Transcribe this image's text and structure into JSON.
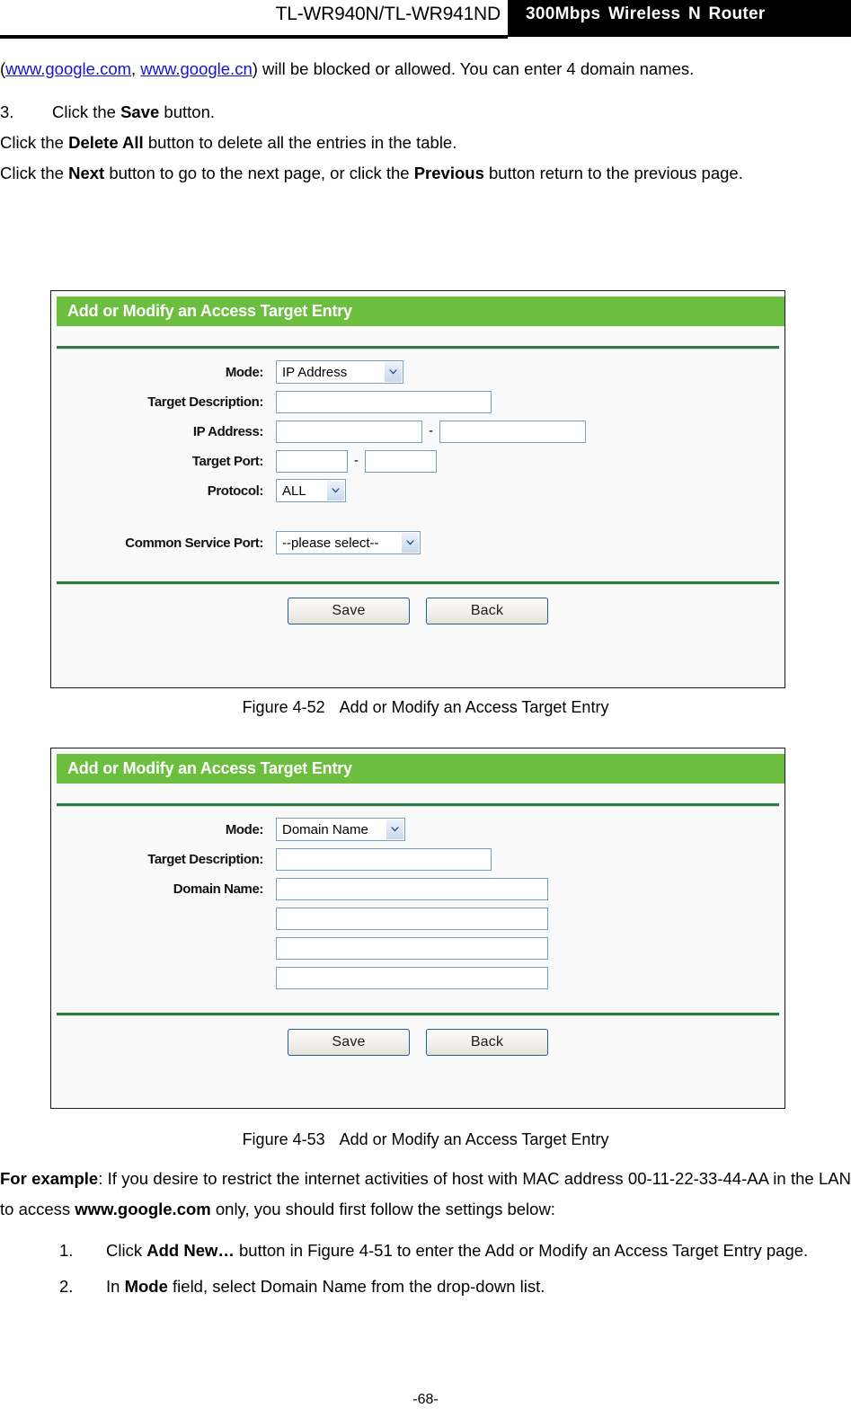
{
  "header": {
    "model": "TL-WR940N/TL-WR941ND",
    "product": "300Mbps Wireless N Router"
  },
  "top_text": {
    "para1_open": "(",
    "link1": "www.google.com",
    "para1_mid": ", ",
    "link2": "www.google.cn",
    "para1_rest": ") will be blocked or allowed. You can enter 4 domain names.",
    "item3_num": "3.",
    "item3_pre": "Click the ",
    "item3_bold": "Save",
    "item3_post": " button.",
    "para_delete_pre": "Click the ",
    "para_delete_bold": "Delete All",
    "para_delete_post": " button to delete all the entries in the table.",
    "para_next_pre": "Click the ",
    "para_next_bold1": "Next",
    "para_next_mid": " button to go to the next page, or click the ",
    "para_next_bold2": "Previous",
    "para_next_post": " button return to the previous page."
  },
  "figure1": {
    "panel_title": "Add or Modify an Access Target Entry",
    "labels": {
      "mode": "Mode:",
      "target_description": "Target Description:",
      "ip_address": "IP Address:",
      "target_port": "Target Port:",
      "protocol": "Protocol:",
      "common_service_port": "Common Service Port:"
    },
    "values": {
      "mode": "IP Address",
      "target_description": "",
      "ip_address_start": "",
      "ip_address_end": "",
      "target_port_start": "",
      "target_port_end": "",
      "protocol": "ALL",
      "common_service_port": "--please select--"
    },
    "separator": "-",
    "buttons": {
      "save": "Save",
      "back": "Back"
    },
    "caption_number": "Figure 4-52",
    "caption_text": "Add or Modify an Access Target Entry"
  },
  "figure2": {
    "panel_title": "Add or Modify an Access Target Entry",
    "labels": {
      "mode": "Mode:",
      "target_description": "Target Description:",
      "domain_name": "Domain Name:"
    },
    "values": {
      "mode": "Domain Name",
      "target_description": "",
      "domain_name_1": "",
      "domain_name_2": "",
      "domain_name_3": "",
      "domain_name_4": ""
    },
    "buttons": {
      "save": "Save",
      "back": "Back"
    },
    "caption_number": "Figure 4-53",
    "caption_text": "Add or Modify an Access Target Entry"
  },
  "bottom_text": {
    "example_bold": "For example",
    "example_rest": ": If you desire to restrict the internet activities of host with MAC address 00-11-22-33-44-AA in the LAN to access ",
    "example_bold2": "www.google.com",
    "example_rest2": " only, you should first follow the settings below:",
    "item1_num": "1.",
    "item1_pre": "Click ",
    "item1_bold": "Add New…",
    "item1_post": " button in Figure 4-51 to enter the Add or Modify an Access Target Entry page.",
    "item2_num": "2.",
    "item2_pre": "In ",
    "item2_bold": "Mode",
    "item2_post": " field, select Domain Name from the drop-down list."
  },
  "footer": {
    "page_number": "-68-"
  },
  "colors": {
    "panel_header_green": "#6cbe3f",
    "divider_green": "#2f7d46",
    "link_blue": "#1414d2",
    "input_border": "#7f9db9",
    "button_border": "#2a5a99"
  },
  "icons": {
    "dropdown": "chevron-down-icon"
  }
}
